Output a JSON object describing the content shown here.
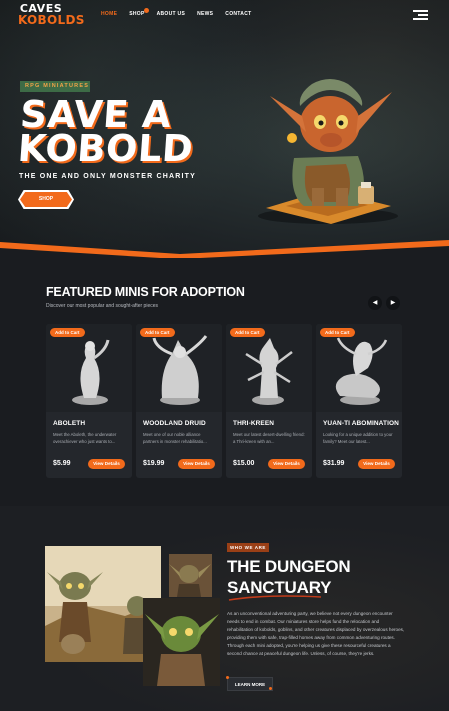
{
  "header": {
    "logo_top": "CAVES",
    "logo_bottom": "KOBOLDS",
    "nav": [
      "HOME",
      "SHOP",
      "ABOUT US",
      "NEWS",
      "CONTACT"
    ],
    "active_nav": "HOME",
    "menu_icon": "hamburger-icon"
  },
  "hero": {
    "eyebrow": "RPG MINIATURES",
    "headline_line1": "SAVE A",
    "headline_line2": "KOBOLD",
    "tagline": "THE ONE AND ONLY MONSTER CHARITY",
    "cta": "SHOP"
  },
  "featured": {
    "title": "FEATURED MINIS FOR ADOPTION",
    "subtitle": "Discover our most popular and sought-after pieces",
    "prev_icon": "chevron-left-icon",
    "next_icon": "chevron-right-icon",
    "add_label": "Add to Cart",
    "view_label": "View Details",
    "cards": [
      {
        "name": "ABOLETH",
        "desc": "Meet the Aboleth, the underwater overachiever who just wants to...",
        "price": "$5.99"
      },
      {
        "name": "WOODLAND DRUID",
        "desc": "Meet one of our noble alliance partners in monster rehabilitatio...",
        "price": "$19.99"
      },
      {
        "name": "THRI-KREEN",
        "desc": "Meet our latest desert-dwelling friend: a Thri-kreen with an...",
        "price": "$15.00"
      },
      {
        "name": "YUAN-TI ABOMINATION",
        "desc": "Looking for a unique addition to your family? Meet our latest...",
        "price": "$31.99"
      }
    ]
  },
  "about": {
    "tag": "WHO WE ARE",
    "title_line1": "THE DUNGEON",
    "title_line2": "SANCTUARY",
    "body": "As an unconventional adventuring party, we believe not every dungeon encounter needs to end in combat. Our miniatures store helps fund the relocation and rehabilitation of kobolds, goblins, and other creatures displaced by overzealous heroes, providing them with safe, trap-filled homes away from common adventuring routes. Through each mini adopted, you're helping us give these resourceful creatures a second chance at peaceful dungeon life. Unless, of course, they're jerks.",
    "cta": "LEARN MORE"
  },
  "colors": {
    "accent": "#f26a1b",
    "eyebrow_bg": "#3d6b46",
    "eyebrow_text": "#f1a348",
    "bg_dark": "#1a1c20",
    "card_bg": "#24272c"
  }
}
